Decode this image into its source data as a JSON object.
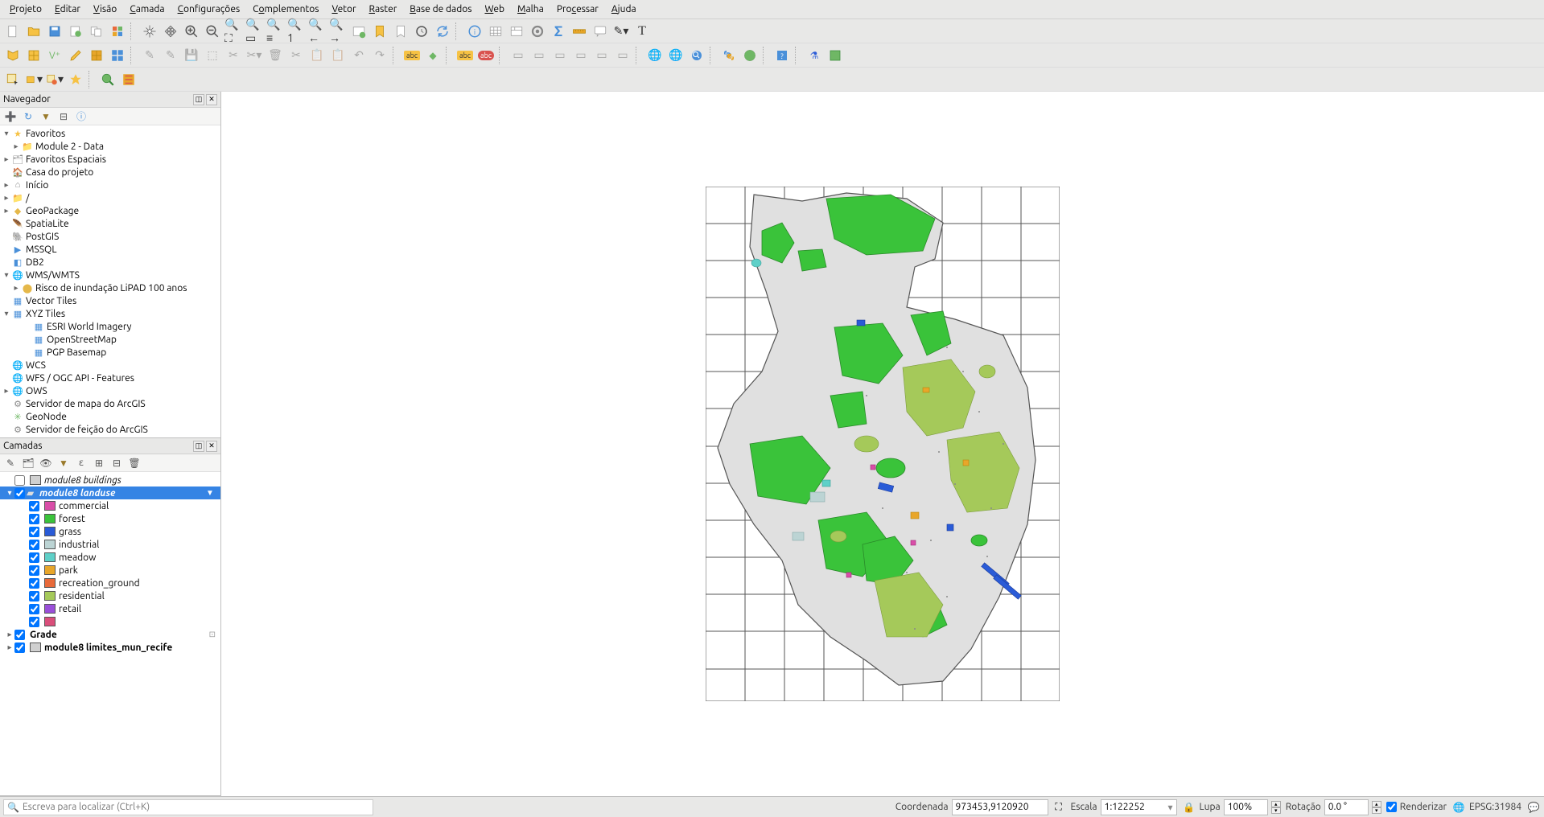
{
  "menu": {
    "items": [
      "Projeto",
      "Editar",
      "Visão",
      "Camada",
      "Configurações",
      "Complementos",
      "Vetor",
      "Raster",
      "Base de dados",
      "Web",
      "Malha",
      "Processar",
      "Ajuda"
    ],
    "underline_idx": [
      0,
      0,
      0,
      0,
      0,
      1,
      0,
      0,
      0,
      0,
      0,
      null,
      null
    ]
  },
  "panels": {
    "browser": {
      "title": "Navegador"
    },
    "layers": {
      "title": "Camadas"
    }
  },
  "browser_tree": [
    {
      "exp": "▾",
      "icon": "★",
      "color": "#f6c244",
      "label": "Favoritos",
      "ind": 0
    },
    {
      "exp": "▸",
      "icon": "📁",
      "color": "#888",
      "label": "Module 2 - Data",
      "ind": 1
    },
    {
      "exp": "▸",
      "icon": "🗂",
      "color": "#888",
      "label": "Favoritos Espaciais",
      "ind": 0
    },
    {
      "exp": "",
      "icon": "🏠",
      "color": "#6fb765",
      "label": "Casa do projeto",
      "ind": 0
    },
    {
      "exp": "▸",
      "icon": "⌂",
      "color": "#888",
      "label": "Início",
      "ind": 0
    },
    {
      "exp": "▸",
      "icon": "📁",
      "color": "#888",
      "label": "/",
      "ind": 0
    },
    {
      "exp": "▸",
      "icon": "◆",
      "color": "#e5b84a",
      "label": "GeoPackage",
      "ind": 0
    },
    {
      "exp": "",
      "icon": "🪶",
      "color": "#4a90d9",
      "label": "SpatiaLite",
      "ind": 0
    },
    {
      "exp": "",
      "icon": "🐘",
      "color": "#4a90d9",
      "label": "PostGIS",
      "ind": 0
    },
    {
      "exp": "",
      "icon": "▶",
      "color": "#4a90d9",
      "label": "MSSQL",
      "ind": 0
    },
    {
      "exp": "",
      "icon": "◧",
      "color": "#4a90d9",
      "label": "DB2",
      "ind": 0
    },
    {
      "exp": "▾",
      "icon": "🌐",
      "color": "#4a90d9",
      "label": "WMS/WMTS",
      "ind": 0
    },
    {
      "exp": "▸",
      "icon": "⬤",
      "color": "#e5b84a",
      "label": "Risco de inundação LiPAD 100 anos",
      "ind": 1
    },
    {
      "exp": "",
      "icon": "▦",
      "color": "#4a90d9",
      "label": "Vector Tiles",
      "ind": 0
    },
    {
      "exp": "▾",
      "icon": "▦",
      "color": "#4a90d9",
      "label": "XYZ Tiles",
      "ind": 0
    },
    {
      "exp": "",
      "icon": "▦",
      "color": "#4a90d9",
      "label": "ESRI World Imagery",
      "ind": 2
    },
    {
      "exp": "",
      "icon": "▦",
      "color": "#4a90d9",
      "label": "OpenStreetMap",
      "ind": 2
    },
    {
      "exp": "",
      "icon": "▦",
      "color": "#4a90d9",
      "label": "PGP Basemap",
      "ind": 2
    },
    {
      "exp": "",
      "icon": "🌐",
      "color": "#4a90d9",
      "label": "WCS",
      "ind": 0
    },
    {
      "exp": "",
      "icon": "🌐",
      "color": "#4a90d9",
      "label": "WFS / OGC API - Features",
      "ind": 0
    },
    {
      "exp": "▸",
      "icon": "🌐",
      "color": "#888",
      "label": "OWS",
      "ind": 0
    },
    {
      "exp": "",
      "icon": "⚙",
      "color": "#888",
      "label": "Servidor de mapa do ArcGIS",
      "ind": 0
    },
    {
      "exp": "",
      "icon": "✳",
      "color": "#6fb765",
      "label": "GeoNode",
      "ind": 0
    },
    {
      "exp": "",
      "icon": "⚙",
      "color": "#888",
      "label": "Servidor de feição do ArcGIS",
      "ind": 0
    }
  ],
  "layers": [
    {
      "type": "child",
      "checked": false,
      "swatch": "#d0d0d0",
      "label": "module8 buildings",
      "italic": true,
      "ind": 1,
      "sel": false
    },
    {
      "type": "group",
      "checked": true,
      "swatch": "",
      "label": "module8 landuse",
      "italic": true,
      "bold": true,
      "ind": 0,
      "sel": true,
      "filter": true,
      "exp": "▾",
      "flag": true
    },
    {
      "type": "cat",
      "checked": true,
      "swatch": "#d94ea8",
      "label": "commercial",
      "ind": 2
    },
    {
      "type": "cat",
      "checked": true,
      "swatch": "#3ac33a",
      "label": "forest",
      "ind": 2
    },
    {
      "type": "cat",
      "checked": true,
      "swatch": "#2a5bd7",
      "label": "grass",
      "ind": 2
    },
    {
      "type": "cat",
      "checked": true,
      "swatch": "#bcd4d4",
      "label": "industrial",
      "ind": 2
    },
    {
      "type": "cat",
      "checked": true,
      "swatch": "#5fd0c8",
      "label": "meadow",
      "ind": 2
    },
    {
      "type": "cat",
      "checked": true,
      "swatch": "#e8a62a",
      "label": "park",
      "ind": 2
    },
    {
      "type": "cat",
      "checked": true,
      "swatch": "#e86a3a",
      "label": "recreation_ground",
      "ind": 2
    },
    {
      "type": "cat",
      "checked": true,
      "swatch": "#a5c95a",
      "label": "residential",
      "ind": 2
    },
    {
      "type": "cat",
      "checked": true,
      "swatch": "#9a4fd9",
      "label": "retail",
      "ind": 2
    },
    {
      "type": "cat",
      "checked": true,
      "swatch": "#d94e7a",
      "label": "",
      "ind": 2
    },
    {
      "type": "group",
      "checked": true,
      "swatch": "",
      "label": "Grade",
      "bold": true,
      "ind": 0,
      "exp": "▸",
      "count": true
    },
    {
      "type": "group",
      "checked": true,
      "swatch": "#d0d0d0",
      "label": "module8 limites_mun_recife",
      "bold": true,
      "ind": 0,
      "exp": "▸"
    }
  ],
  "statusbar": {
    "locator_placeholder": "Escreva para localizar (Ctrl+K)",
    "coord_label": "Coordenada",
    "coord_value": "973453,9120920",
    "scale_label": "Escala",
    "scale_value": "1:122252",
    "magnifier_label": "Lupa",
    "magnifier_value": "100%",
    "rotation_label": "Rotação",
    "rotation_value": "0.0 °",
    "render_label": "Renderizar",
    "crs_label": "EPSG:31984"
  }
}
